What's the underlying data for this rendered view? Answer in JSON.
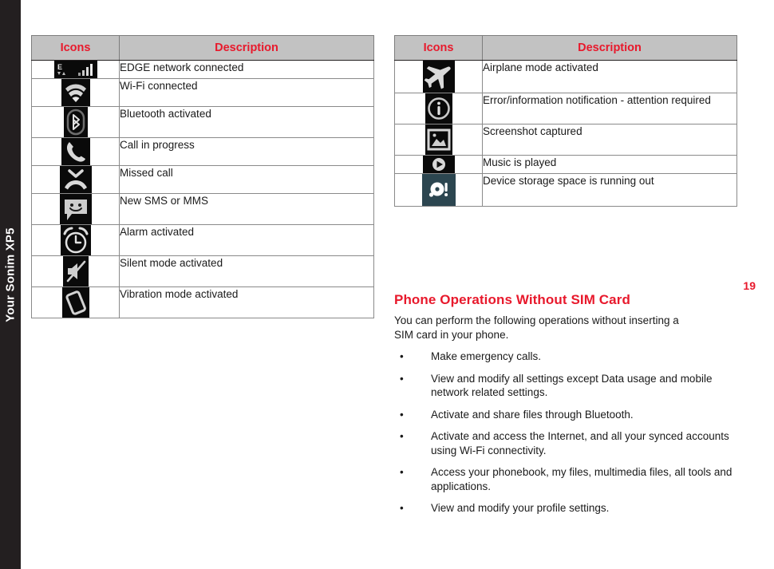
{
  "sidebar": {
    "label": "Your Sonim XP5"
  },
  "page_number": "19",
  "colors": {
    "accent_red": "#e8192c",
    "header_gray": "#c2c2c2",
    "sidebar_dark": "#231f20",
    "icon_black": "#050505",
    "icon_teal": "#2c4650"
  },
  "tables": [
    {
      "id": "left",
      "headers": {
        "icons": "Icons",
        "description": "Description"
      },
      "rows": [
        {
          "icon": "edge-network-icon",
          "description": "EDGE network connected"
        },
        {
          "icon": "wifi-connected-icon",
          "description": "Wi-Fi connected"
        },
        {
          "icon": "bluetooth-icon",
          "description": "Bluetooth activated"
        },
        {
          "icon": "call-in-progress-icon",
          "description": "Call in progress"
        },
        {
          "icon": "missed-call-icon",
          "description": "Missed call"
        },
        {
          "icon": "new-message-icon",
          "description": "New SMS or MMS"
        },
        {
          "icon": "alarm-clock-icon",
          "description": "Alarm activated"
        },
        {
          "icon": "silent-mode-icon",
          "description": "Silent mode activated"
        },
        {
          "icon": "vibration-mode-icon",
          "description": "Vibration mode activated"
        }
      ]
    },
    {
      "id": "right",
      "headers": {
        "icons": "Icons",
        "description": "Description"
      },
      "rows": [
        {
          "icon": "airplane-mode-icon",
          "description": "Airplane mode activated"
        },
        {
          "icon": "info-notification-icon",
          "description": "Error/information notification - attention required"
        },
        {
          "icon": "screenshot-icon",
          "description": "Screenshot captured"
        },
        {
          "icon": "music-play-icon",
          "description": "Music is played"
        },
        {
          "icon": "storage-low-icon",
          "description": "Device storage space is running out"
        }
      ]
    }
  ],
  "section": {
    "title": "Phone Operations Without SIM Card",
    "intro": "You can perform the following operations without inserting a SIM card in your phone.",
    "bullet_char": "•",
    "bullets": [
      "Make emergency calls.",
      "View and modify all settings except Data usage and mobile network related settings.",
      "Activate and share files through Bluetooth.",
      "Activate and access the Internet, and all your synced accounts using Wi-Fi connectivity.",
      "Access your phonebook, my files, multimedia files, all tools and applications.",
      "View and modify your profile settings."
    ]
  }
}
